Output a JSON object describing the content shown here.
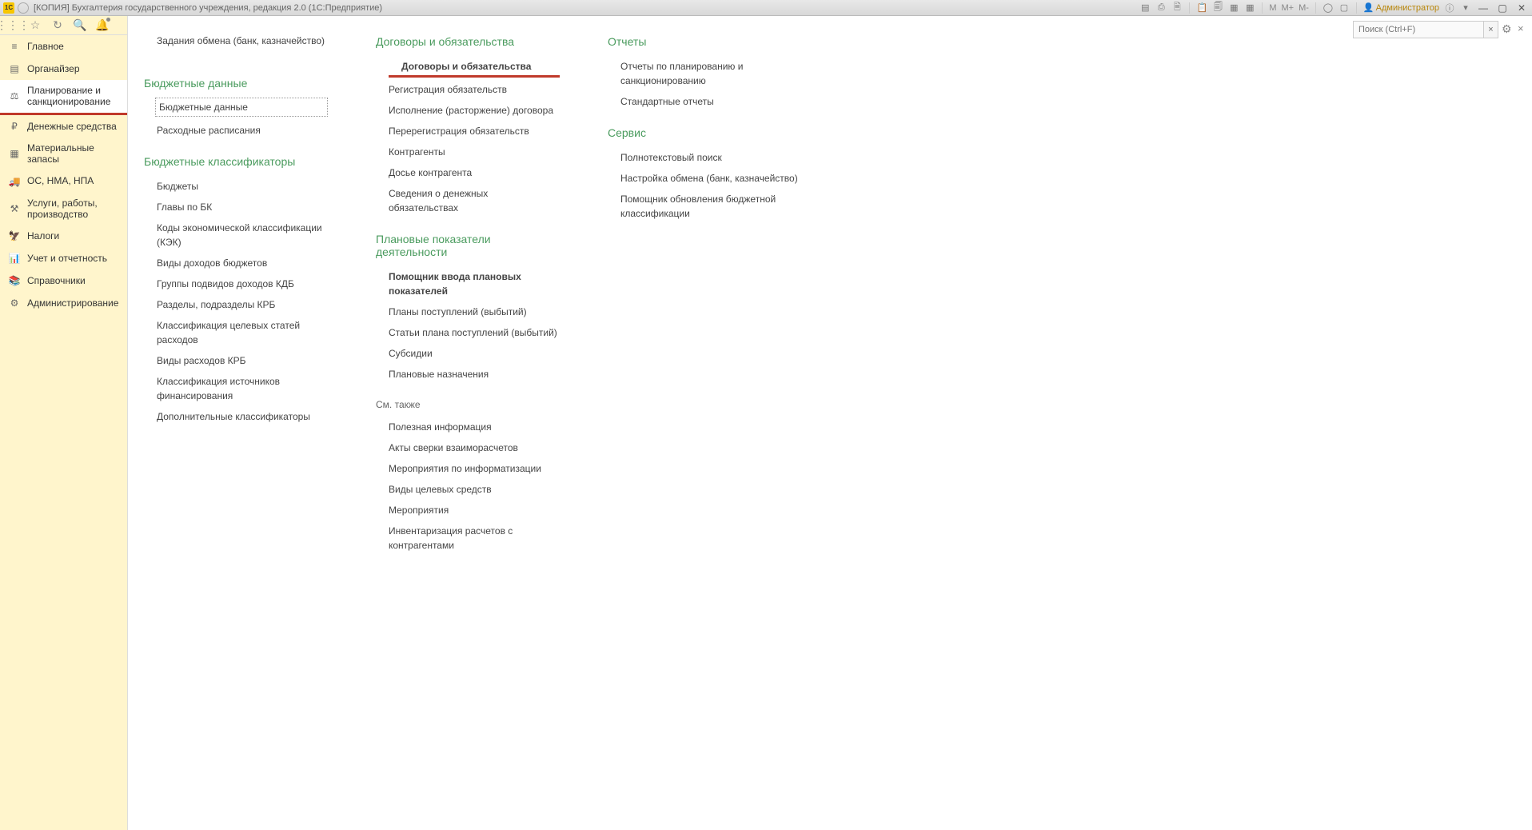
{
  "titlebar": {
    "logo_text": "1С",
    "title": "[КОПИЯ] Бухгалтерия государственного учреждения, редакция 2.0  (1С:Предприятие)",
    "admin_label": "Администратор",
    "m_label": "M",
    "m_plus": "M+",
    "m_minus": "M-"
  },
  "search": {
    "placeholder": "Поиск (Ctrl+F)"
  },
  "sidebar": {
    "items": [
      {
        "label": "Главное"
      },
      {
        "label": "Органайзер"
      },
      {
        "label": "Планирование и санкционирование"
      },
      {
        "label": "Денежные средства"
      },
      {
        "label": "Материальные запасы"
      },
      {
        "label": "ОС, НМА, НПА"
      },
      {
        "label": "Услуги, работы, производство"
      },
      {
        "label": "Налоги"
      },
      {
        "label": "Учет и отчетность"
      },
      {
        "label": "Справочники"
      },
      {
        "label": "Администрирование"
      }
    ]
  },
  "col1": {
    "top_link": "Задания обмена (банк, казначейство)",
    "s1_title": "Бюджетные данные",
    "s1_links": [
      "Бюджетные данные",
      "Расходные расписания"
    ],
    "s2_title": "Бюджетные классификаторы",
    "s2_links": [
      "Бюджеты",
      "Главы по БК",
      "Коды экономической классификации (КЭК)",
      "Виды доходов бюджетов",
      "Группы подвидов доходов КДБ",
      "Разделы, подразделы КРБ",
      "Классификация целевых статей расходов",
      "Виды расходов КРБ",
      "Классификация источников финансирования",
      "Дополнительные классификаторы"
    ]
  },
  "col2": {
    "s1_title": "Договоры и обязательства",
    "s1_links": [
      "Договоры и обязательства",
      "Регистрация обязательств",
      "Исполнение (расторжение) договора",
      "Перерегистрация обязательств",
      "Контрагенты",
      "Досье контрагента",
      "Сведения о денежных обязательствах"
    ],
    "s2_title": "Плановые показатели деятельности",
    "s2_links": [
      "Помощник ввода плановых показателей",
      "Планы поступлений (выбытий)",
      "Статьи плана поступлений (выбытий)",
      "Субсидии",
      "Плановые назначения"
    ],
    "s3_subtitle": "См. также",
    "s3_links": [
      "Полезная информация",
      "Акты сверки взаиморасчетов",
      "Мероприятия по информатизации",
      "Виды целевых средств",
      "Мероприятия",
      "Инвентаризация расчетов с контрагентами"
    ]
  },
  "col3": {
    "s1_title": "Отчеты",
    "s1_links": [
      "Отчеты по планированию и санкционированию",
      "Стандартные отчеты"
    ],
    "s2_title": "Сервис",
    "s2_links": [
      "Полнотекстовый поиск",
      "Настройка обмена (банк, казначейство)",
      "Помощник обновления бюджетной классификации"
    ]
  }
}
